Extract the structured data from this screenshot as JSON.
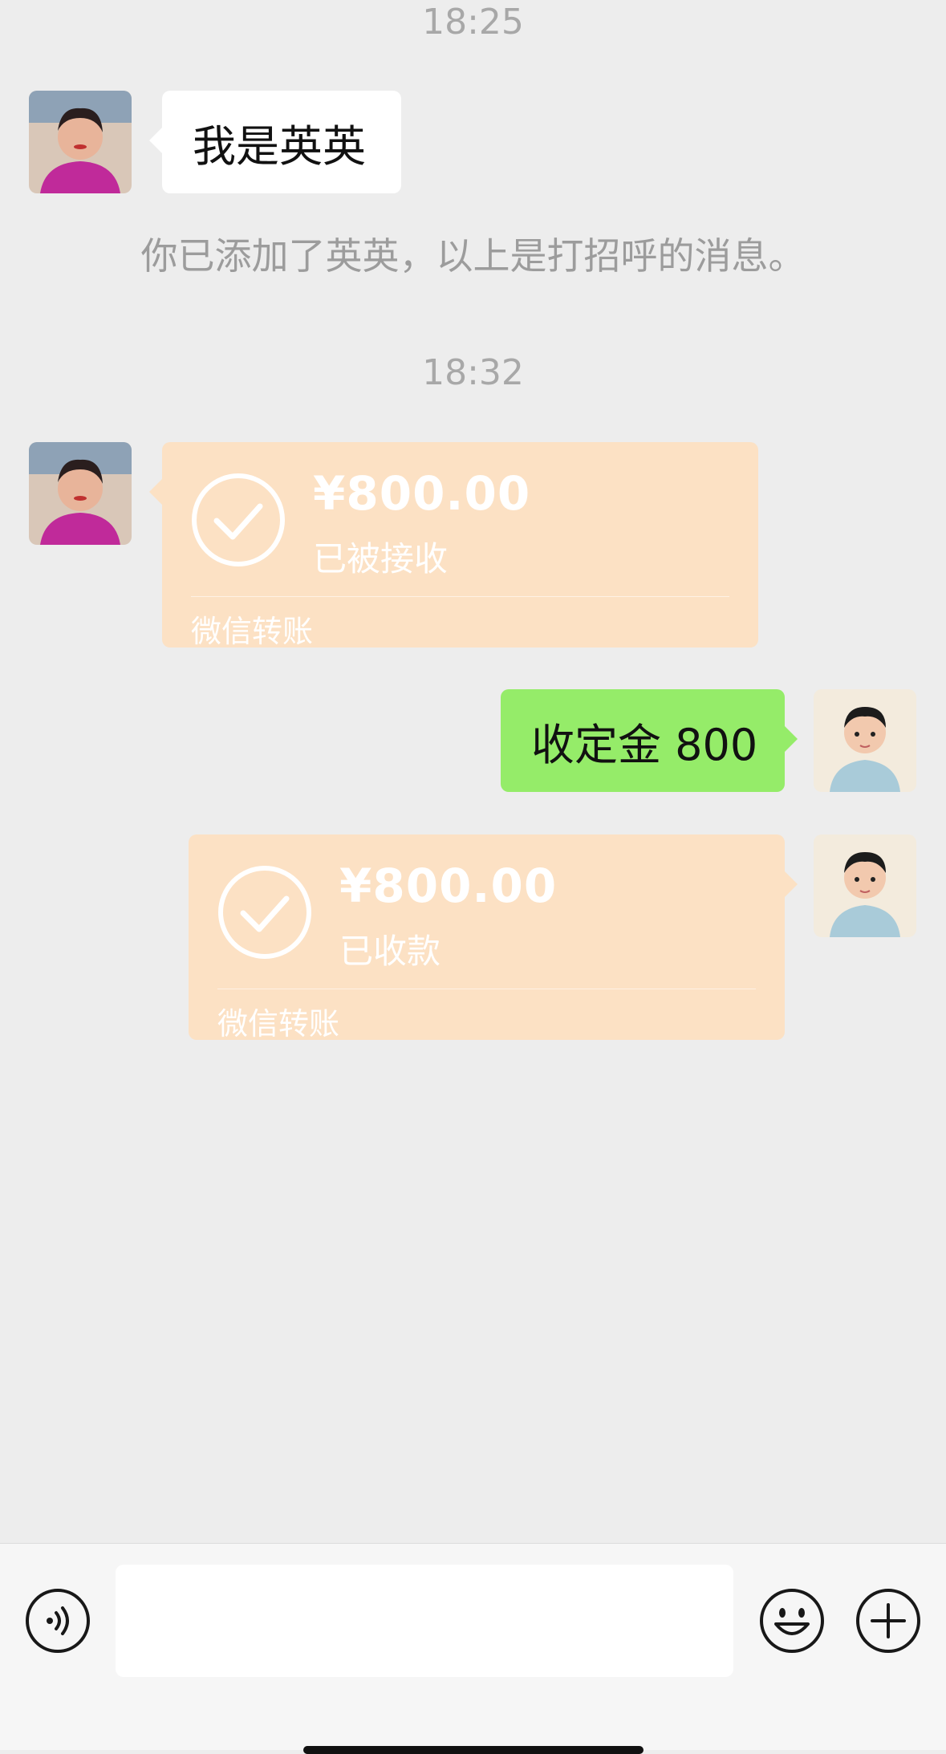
{
  "messages": {
    "time1": "18:25",
    "intro_text": "我是英英",
    "system_notice": "你已添加了英英，以上是打招呼的消息。",
    "time2": "18:32",
    "transfer_received": {
      "amount": "¥800.00",
      "status": "已被接收",
      "source": "微信转账"
    },
    "sent_text": "收定金 800",
    "transfer_sent": {
      "amount": "¥800.00",
      "status": "已收款",
      "source": "微信转账"
    }
  },
  "colors": {
    "background": "#ededed",
    "self_bubble": "#95ec69",
    "transfer_bubble": "#fce1c4"
  },
  "icons": {
    "voice": "voice-icon",
    "emoji": "emoji-icon",
    "more": "plus-icon",
    "check": "check-circle-icon"
  }
}
